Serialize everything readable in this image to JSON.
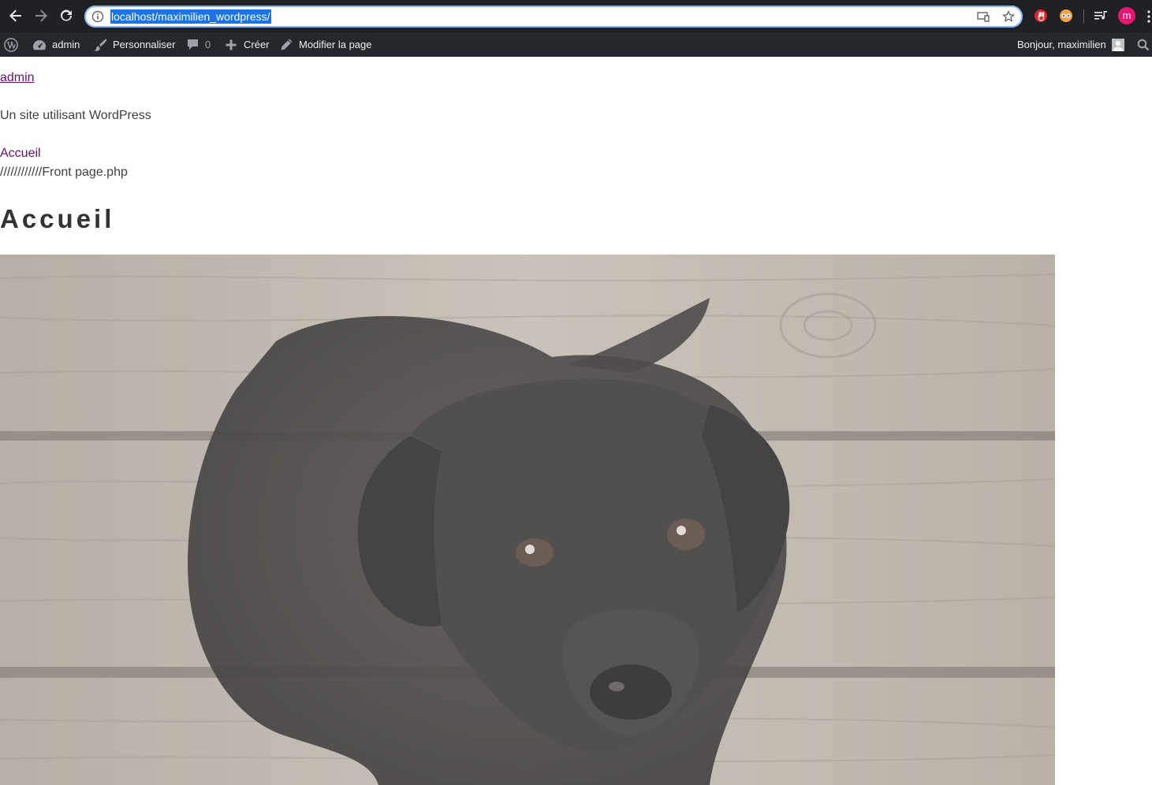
{
  "browser": {
    "url": "localhost/maximilien_wordpress/",
    "profile_initial": "m",
    "icons": [
      "back-arrow-icon",
      "forward-arrow-icon",
      "reload-icon",
      "site-info-icon",
      "cast-icon",
      "bookmark-star-icon",
      "extension-red-icon",
      "extension-eyes-icon",
      "media-queue-icon",
      "profile-avatar",
      "menu-kebab-icon"
    ]
  },
  "admin_bar": {
    "site_name": "admin",
    "customize": "Personnaliser",
    "comments_count": "0",
    "new": "Créer",
    "edit_page": "Modifier la page",
    "greeting": "Bonjour, maximilien",
    "icons": [
      "wordpress-logo-icon",
      "dashboard-icon",
      "paintbrush-icon",
      "comment-icon",
      "plus-icon",
      "pencil-icon",
      "user-avatar-icon",
      "search-icon"
    ]
  },
  "page": {
    "site_title": "admin",
    "tagline": "Un site utilisant WordPress",
    "menu_item": "Accueil",
    "template_note": "////////////Front page.php",
    "title": "Accueil",
    "hero_image": "black-puppy-on-wooden-floor"
  },
  "colors": {
    "browser_chrome": "#202124",
    "url_highlight": "#1a73e8",
    "admin_bar": "#23282d",
    "visited_link": "#6b0f6b",
    "profile_avatar": "#e5176f"
  }
}
